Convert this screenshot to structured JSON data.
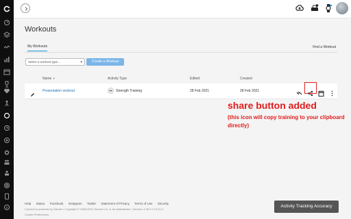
{
  "topbar": {
    "toggle_icon": "chevron-right-icon",
    "icons": [
      "upload-icon",
      "inbox-icon",
      "watch-icon",
      "avatar"
    ]
  },
  "page": {
    "title": "Workouts"
  },
  "tabs": {
    "my_workouts": "My Workouts",
    "find": "Find a Workout"
  },
  "filters": {
    "select_value": "Select a workout type...",
    "create_label": "Create a Workout"
  },
  "table": {
    "headers": [
      "Name",
      "Activity Type",
      "Edited",
      "Created"
    ],
    "rows": [
      {
        "name": "Presentation workout",
        "activity": "Strength Training",
        "edited": "28 Feb 2021",
        "created": "28 Feb 2021"
      }
    ]
  },
  "annotation": {
    "title": "share button added",
    "subtitle": "(this icon will copy training to your clipboard directly)"
  },
  "footer": {
    "links": [
      "Help",
      "Status",
      "Facebook",
      "Instagram",
      "Twitter",
      "Statement of Privacy",
      "Terms of Use",
      "Security"
    ],
    "line1": "Connect is powered by Garmin • Copyright © 1996-2021 Garmin Ltd. or its subsidiaries • Version: 4.39.2.0 21.41.2",
    "line2": "Cookie Preferences",
    "accuracy_button": "Activity Tracking Accuracy"
  },
  "colors": {
    "accent": "#1a8fd1",
    "annotation": "#e01b1b",
    "sidebar": "#0f0f0f"
  }
}
